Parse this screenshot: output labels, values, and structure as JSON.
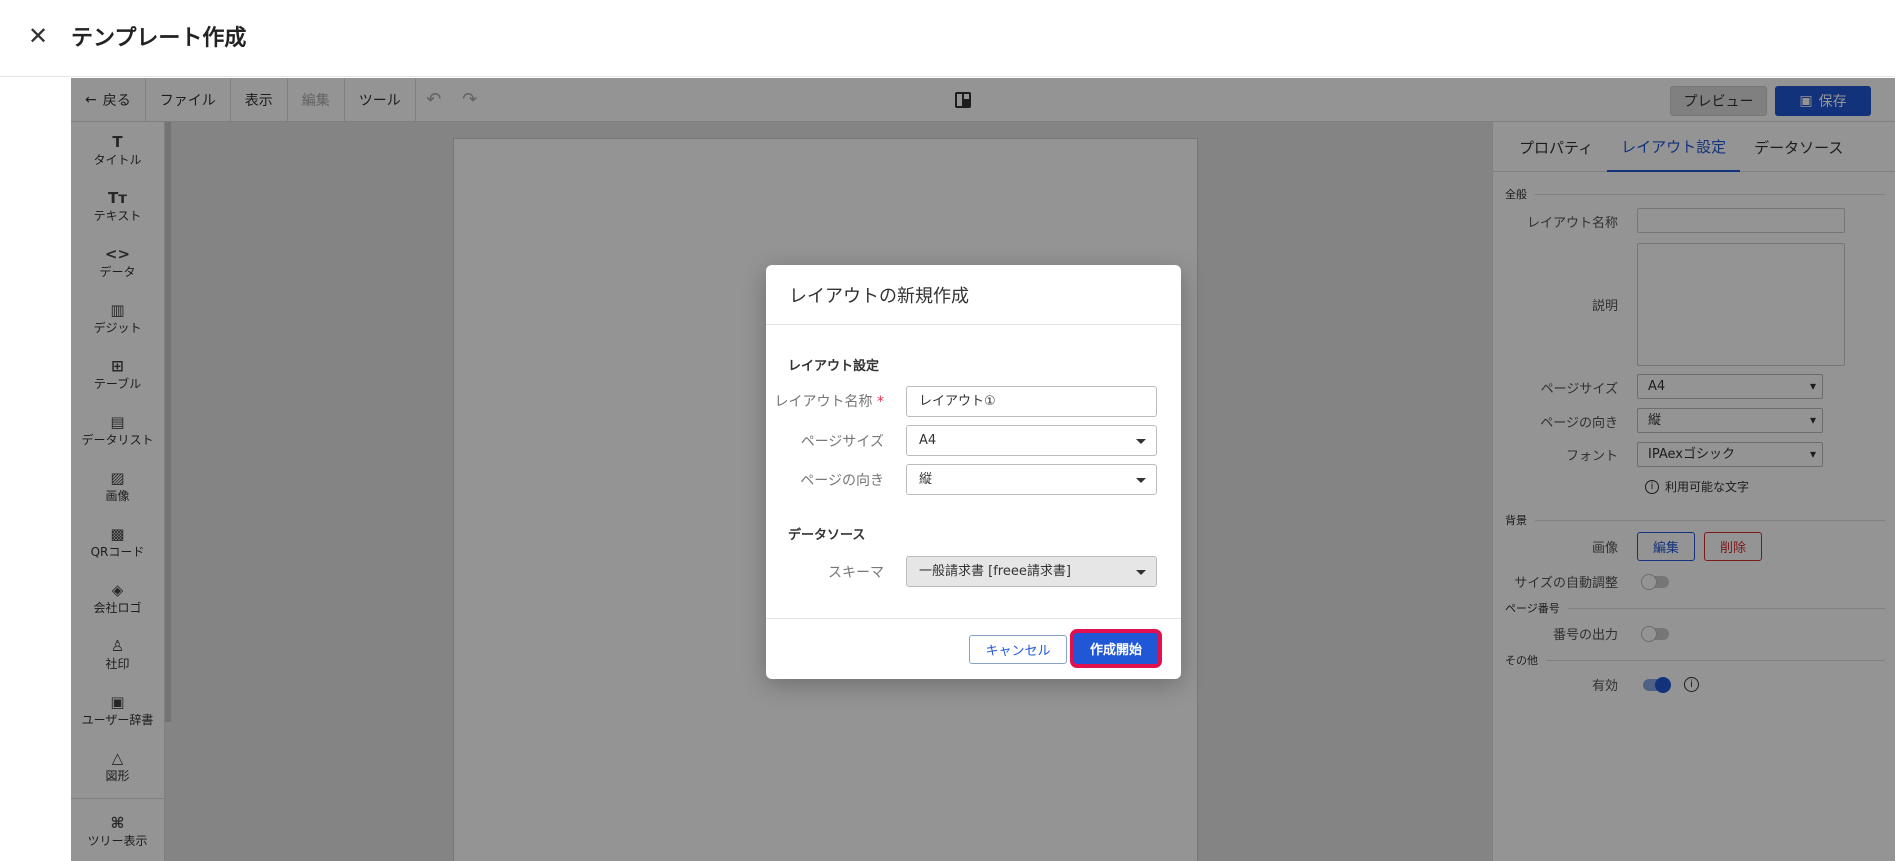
{
  "header": {
    "title": "テンプレート作成",
    "close_glyph": "✕"
  },
  "toolbar": {
    "back": "戻る",
    "file": "ファイル",
    "view": "表示",
    "edit": "編集",
    "tools": "ツール",
    "preview": "プレビュー",
    "save": "保存"
  },
  "sidebar": {
    "items": [
      {
        "icon": "T",
        "label": "タイトル"
      },
      {
        "icon": "Tт",
        "label": "テキスト"
      },
      {
        "icon": "<>",
        "label": "データ"
      },
      {
        "icon": "▥",
        "label": "デジット"
      },
      {
        "icon": "⊞",
        "label": "テーブル"
      },
      {
        "icon": "▤",
        "label": "データリスト"
      },
      {
        "icon": "▨",
        "label": "画像"
      },
      {
        "icon": "▩",
        "label": "QRコード"
      },
      {
        "icon": "◈",
        "label": "会社ロゴ"
      },
      {
        "icon": "♙",
        "label": "社印"
      },
      {
        "icon": "▣",
        "label": "ユーザー辞書"
      },
      {
        "icon": "△",
        "label": "図形"
      },
      {
        "icon": "⌘",
        "label": "ツリー表示"
      }
    ]
  },
  "rpanel": {
    "tabs": [
      "プロパティ",
      "レイアウト設定",
      "データソース"
    ],
    "sec_general": "全般",
    "layout_name": "レイアウト名称",
    "description": "説明",
    "page_size": "ページサイズ",
    "page_size_value": "A4",
    "orientation": "ページの向き",
    "orientation_value": "縦",
    "font": "フォント",
    "font_value": "IPAexゴシック",
    "available_chars": "利用可能な文字",
    "sec_background": "背景",
    "image": "画像",
    "edit_btn": "編集",
    "delete_btn": "削除",
    "auto_resize": "サイズの自動調整",
    "sec_page_number": "ページ番号",
    "number_output": "番号の出力",
    "sec_other": "その他",
    "enabled": "有効"
  },
  "dialog": {
    "title": "レイアウトの新規作成",
    "sec_layout": "レイアウト設定",
    "name_label": "レイアウト名称",
    "required_mark": "*",
    "name_value": "レイアウト①",
    "size_label": "ページサイズ",
    "size_value": "A4",
    "orient_label": "ページの向き",
    "orient_value": "縦",
    "sec_datasource": "データソース",
    "schema_label": "スキーマ",
    "schema_value": "一般請求書 [freee請求書]",
    "cancel": "キャンセル",
    "start": "作成開始"
  },
  "colors": {
    "accent": "#1f57d6",
    "highlight": "#e3104f"
  }
}
